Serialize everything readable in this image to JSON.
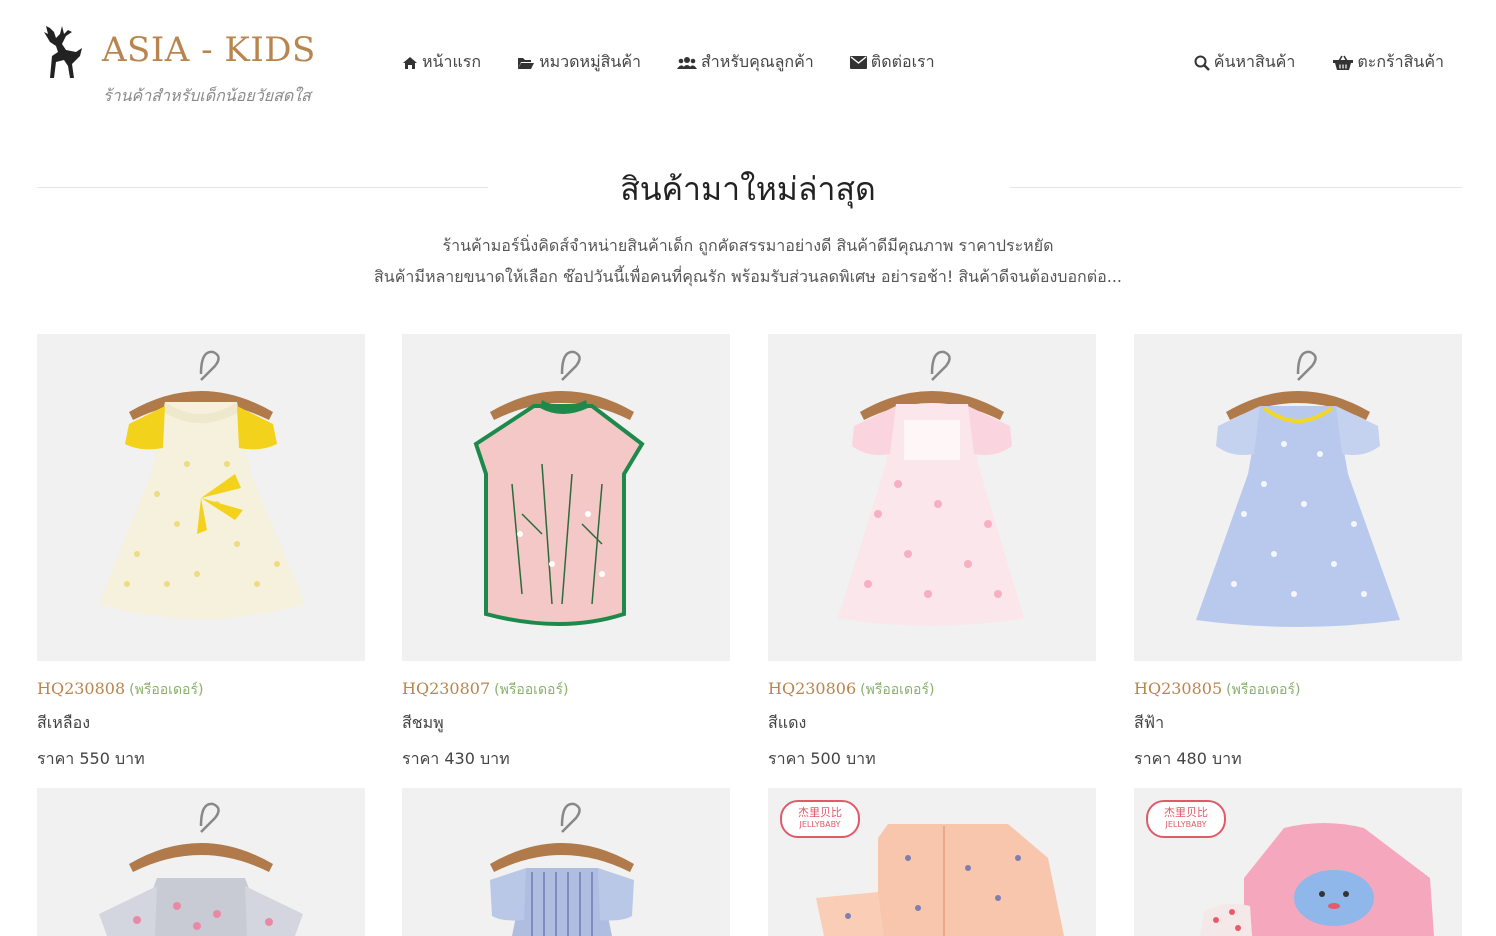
{
  "brand": {
    "title": "ASIA - KIDS",
    "tagline": "ร้านค้าสำหรับเด็กน้อยวัยสดใส"
  },
  "nav": {
    "left": [
      {
        "label": "หน้าแรก",
        "icon": "home-icon"
      },
      {
        "label": "หมวดหมู่สินค้า",
        "icon": "folder-open-icon"
      },
      {
        "label": "สำหรับคุณลูกค้า",
        "icon": "users-icon"
      },
      {
        "label": "ติดต่อเรา",
        "icon": "envelope-icon"
      }
    ],
    "right": [
      {
        "label": "ค้นหาสินค้า",
        "icon": "search-icon"
      },
      {
        "label": "ตะกร้าสินค้า",
        "icon": "basket-icon"
      }
    ]
  },
  "section": {
    "title": "สินค้ามาใหม่ล่าสุด",
    "desc_line1": "ร้านค้ามอร์นิ่งคิดส์จำหน่ายสินค้าเด็ก ถูกคัดสรรมาอย่างดี สินค้าดีมีคุณภาพ ราคาประหยัด",
    "desc_line2": "สินค้ามีหลายขนาดให้เลือก ช๊อปวันนี้เพื่อคนที่คุณรัก พร้อมรับส่วนลดพิเศษ อย่ารอช้า! สินค้าดีจนต้องบอกต่อ..."
  },
  "products": [
    {
      "code": "HQ230808",
      "tag": "(พรีออเดอร์)",
      "color": "สีเหลือง",
      "price": "ราคา 550 บาท"
    },
    {
      "code": "HQ230807",
      "tag": "(พรีออเดอร์)",
      "color": "สีชมพู",
      "price": "ราคา 430 บาท"
    },
    {
      "code": "HQ230806",
      "tag": "(พรีออเดอร์)",
      "color": "สีแดง",
      "price": "ราคา 500 บาท"
    },
    {
      "code": "HQ230805",
      "tag": "(พรีออเดอร์)",
      "color": "สีฟ้า",
      "price": "ราคา 480 บาท"
    }
  ],
  "second_row_logos": [
    "杰里贝比",
    "JELLYBABY"
  ],
  "colors": {
    "brand": "#b9854f",
    "preorder": "#8ab06e",
    "image_bg": "#f1f1f1"
  }
}
